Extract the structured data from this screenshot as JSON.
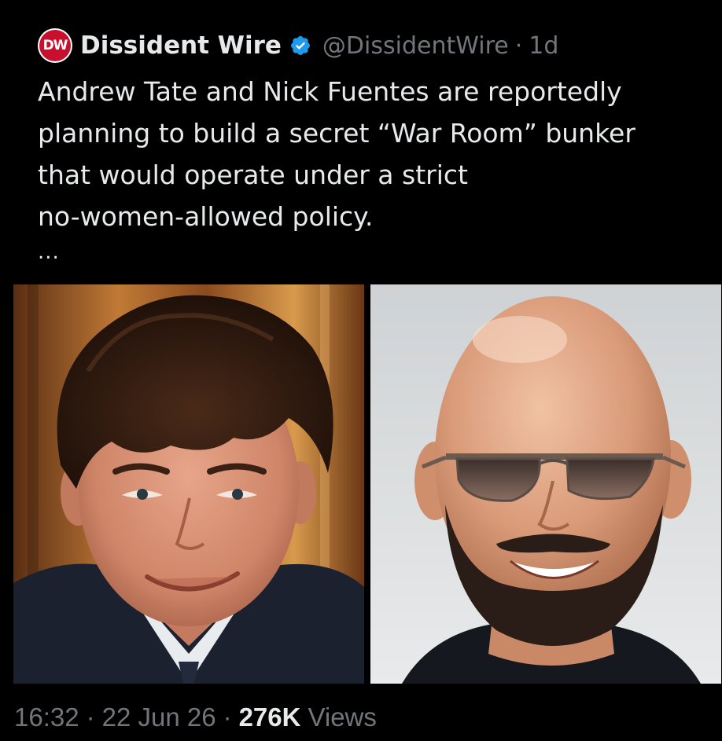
{
  "post": {
    "author": {
      "avatar_text": "DW",
      "display_name": "Dissident Wire",
      "handle": "@DissidentWire",
      "separator": "·",
      "time_ago": "1d",
      "verified_icon": "verified-badge-icon"
    },
    "text_lines": [
      "Andrew Tate and Nick Fuentes are reportedly",
      "planning to build a secret “War Room” bunker",
      "that would operate under a strict",
      "no-women-allowed policy."
    ],
    "ellipsis": "...",
    "media": [
      {
        "kind": "photo",
        "subject": "portrait-man-dark-hair-suit"
      },
      {
        "kind": "photo",
        "subject": "portrait-bald-man-sunglasses-beard"
      }
    ],
    "footer": {
      "time": "16:32",
      "date": "22 Jun 26",
      "sep": "·",
      "views_count": "276K",
      "views_label": "Views"
    }
  },
  "colors": {
    "background": "#000000",
    "primary_text": "#e7e9ea",
    "secondary_text": "#71767b",
    "verified_blue": "#1d9bf0",
    "avatar_red": "#c8102e"
  }
}
